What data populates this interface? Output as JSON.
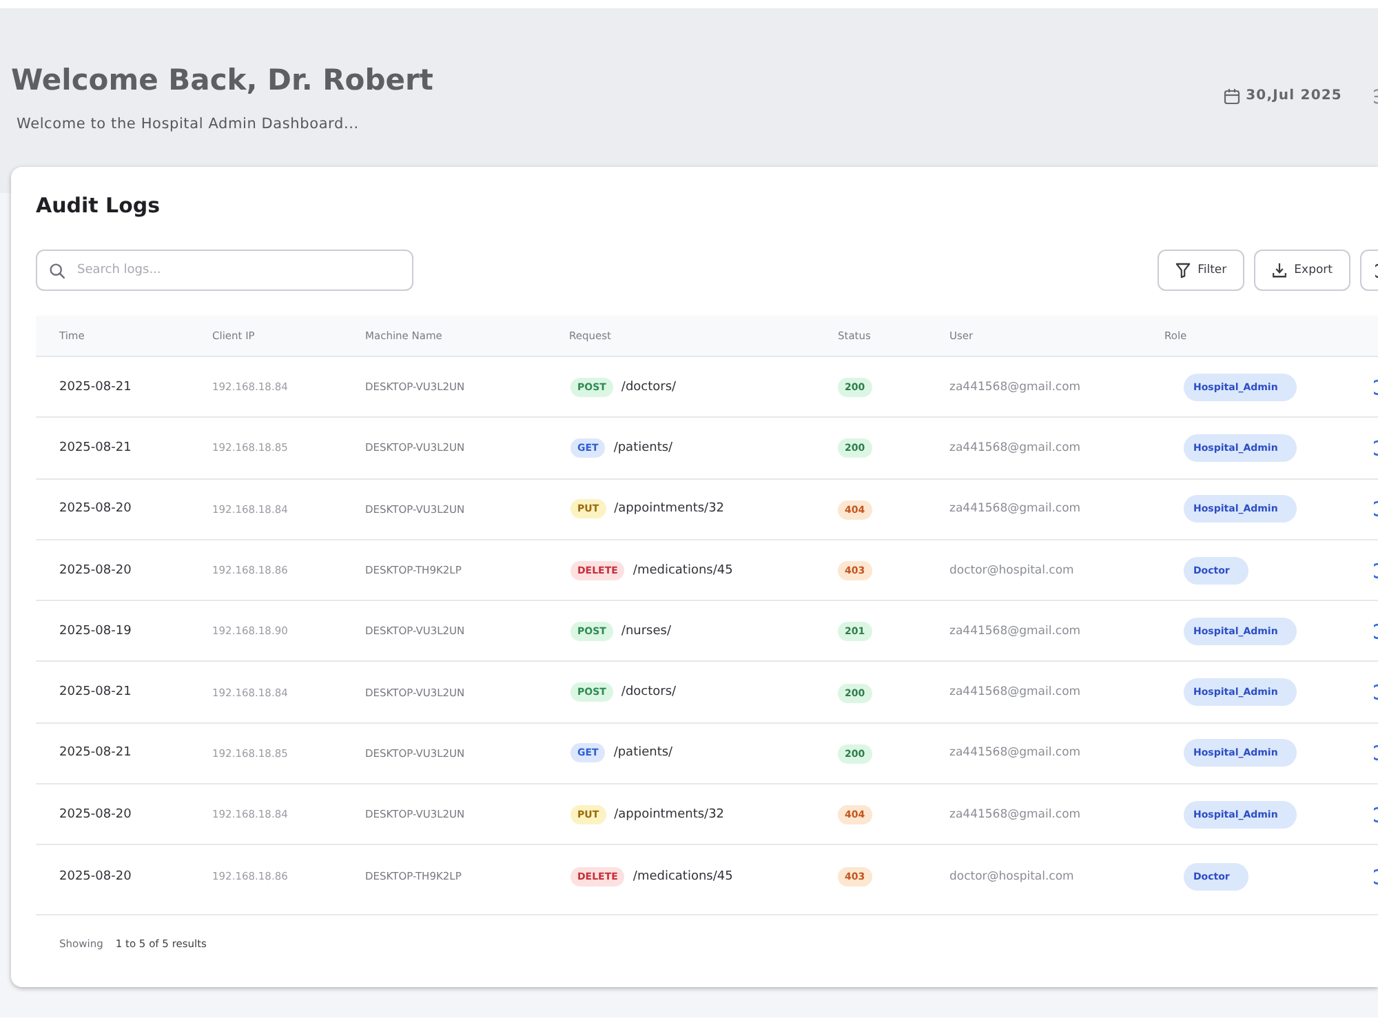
{
  "header": {
    "title": "Welcome Back, Dr. Robert",
    "subtitle": "Welcome to the Hospital Admin Dashboard...",
    "date": "30,Jul 2025"
  },
  "audit_logs": {
    "title": "Audit Logs",
    "search": {
      "placeholder": "Search logs..."
    },
    "buttons": [
      {
        "kind": "filter",
        "label": "Filter"
      },
      {
        "kind": "export",
        "label": "Export"
      }
    ],
    "table": {
      "columns": [
        "Time",
        "Client IP",
        "Machine Name",
        "Request",
        "Status",
        "User",
        "Role"
      ],
      "rows": [
        {
          "time": "2025-08-21",
          "client_ip": "192.168.18.84",
          "machine": "DESKTOP-VU3L2UN",
          "method": {
            "kind": "post",
            "label": "POST"
          },
          "path": "/doctors/",
          "status": {
            "kind": "success",
            "label": "200"
          },
          "user": "za441568@gmail.com",
          "role": "Hospital_Admin"
        },
        {
          "time": "2025-08-21",
          "client_ip": "192.168.18.85",
          "machine": "DESKTOP-VU3L2UN",
          "method": {
            "kind": "get",
            "label": "GET"
          },
          "path": "/patients/",
          "status": {
            "kind": "success",
            "label": "200"
          },
          "user": "za441568@gmail.com",
          "role": "Hospital_Admin"
        },
        {
          "time": "2025-08-20",
          "client_ip": "192.168.18.84",
          "machine": "DESKTOP-VU3L2UN",
          "method": {
            "kind": "put",
            "label": "PUT"
          },
          "path": "/appointments/32",
          "status": {
            "kind": "error",
            "label": "404"
          },
          "user": "za441568@gmail.com",
          "role": "Hospital_Admin"
        },
        {
          "time": "2025-08-20",
          "client_ip": "192.168.18.86",
          "machine": "DESKTOP-TH9K2LP",
          "method": {
            "kind": "delete",
            "label": "DELETE"
          },
          "path": "/medications/45",
          "status": {
            "kind": "error",
            "label": "403"
          },
          "user": "doctor@hospital.com",
          "role": "Doctor"
        },
        {
          "time": "2025-08-19",
          "client_ip": "192.168.18.90",
          "machine": "DESKTOP-VU3L2UN",
          "method": {
            "kind": "post",
            "label": "POST"
          },
          "path": "/nurses/",
          "status": {
            "kind": "success",
            "label": "201"
          },
          "user": "za441568@gmail.com",
          "role": "Hospital_Admin"
        },
        {
          "time": "2025-08-21",
          "client_ip": "192.168.18.84",
          "machine": "DESKTOP-VU3L2UN",
          "method": {
            "kind": "post",
            "label": "POST"
          },
          "path": "/doctors/",
          "status": {
            "kind": "success",
            "label": "200"
          },
          "user": "za441568@gmail.com",
          "role": "Hospital_Admin"
        },
        {
          "time": "2025-08-21",
          "client_ip": "192.168.18.85",
          "machine": "DESKTOP-VU3L2UN",
          "method": {
            "kind": "get",
            "label": "GET"
          },
          "path": "/patients/",
          "status": {
            "kind": "success",
            "label": "200"
          },
          "user": "za441568@gmail.com",
          "role": "Hospital_Admin"
        },
        {
          "time": "2025-08-20",
          "client_ip": "192.168.18.84",
          "machine": "DESKTOP-VU3L2UN",
          "method": {
            "kind": "put",
            "label": "PUT"
          },
          "path": "/appointments/32",
          "status": {
            "kind": "error",
            "label": "404"
          },
          "user": "za441568@gmail.com",
          "role": "Hospital_Admin"
        },
        {
          "time": "2025-08-20",
          "client_ip": "192.168.18.86",
          "machine": "DESKTOP-TH9K2LP",
          "method": {
            "kind": "delete",
            "label": "DELETE"
          },
          "path": "/medications/45",
          "status": {
            "kind": "error",
            "label": "403"
          },
          "user": "doctor@hospital.com",
          "role": "Doctor"
        }
      ]
    },
    "footer": {
      "label": "Showing",
      "range": "1 to 5 of 5 results"
    }
  }
}
